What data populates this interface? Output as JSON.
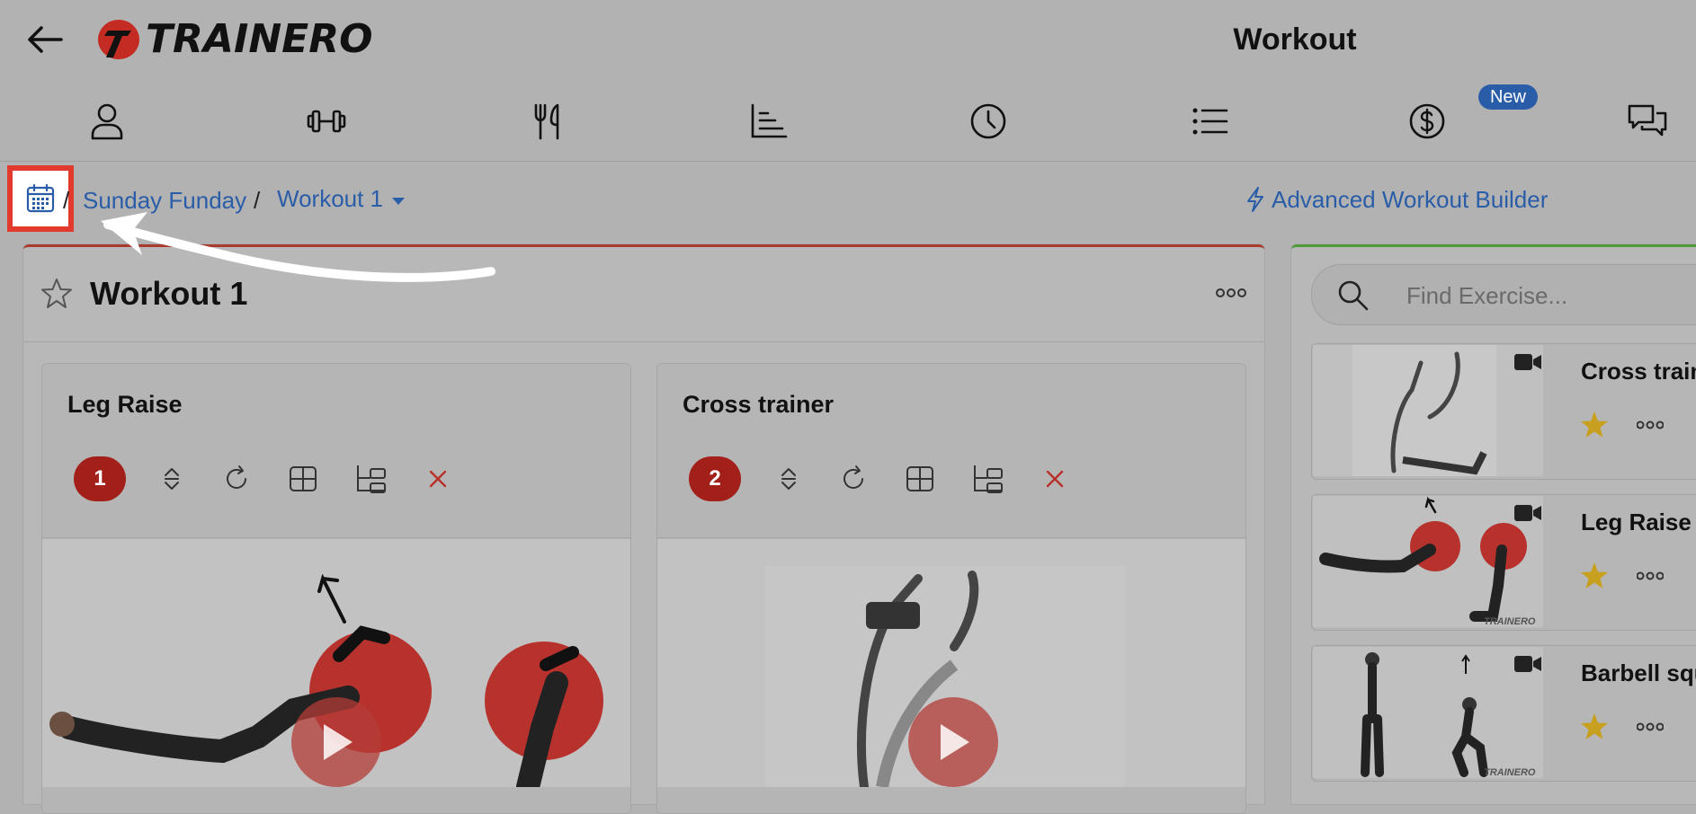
{
  "header": {
    "back_icon": "arrow-left-icon",
    "logo_text": "TRAINERO",
    "page_title": "Workout"
  },
  "nav": {
    "items": [
      {
        "icon": "user-icon"
      },
      {
        "icon": "dumbbell-icon"
      },
      {
        "icon": "fork-knife-icon"
      },
      {
        "icon": "chart-icon"
      },
      {
        "icon": "clock-icon"
      },
      {
        "icon": "list-icon"
      },
      {
        "icon": "dollar-icon",
        "badge": "New"
      },
      {
        "icon": "chat-icon"
      }
    ]
  },
  "breadcrumb": {
    "calendar_icon": "calendar-icon",
    "program": "Sunday Funday",
    "separator": "/",
    "workout": "Workout 1",
    "advanced_builder": "Advanced Workout Builder"
  },
  "workout": {
    "title": "Workout 1",
    "exercises": [
      {
        "name": "Leg Raise",
        "number": "1",
        "watermark": ""
      },
      {
        "name": "Cross trainer",
        "number": "2",
        "watermark": ""
      }
    ]
  },
  "library": {
    "search_placeholder": "Find Exercise...",
    "items": [
      {
        "name": "Cross trainer",
        "watermark": ""
      },
      {
        "name": "Leg Raise",
        "watermark": "TRAINERO"
      },
      {
        "name": "Barbell squat",
        "watermark": "TRAINERO"
      }
    ]
  },
  "colors": {
    "accent_blue": "#2a5da8",
    "brand_red": "#a3201a",
    "highlight_red": "#e23a2c",
    "star_gold": "#c8a020"
  }
}
